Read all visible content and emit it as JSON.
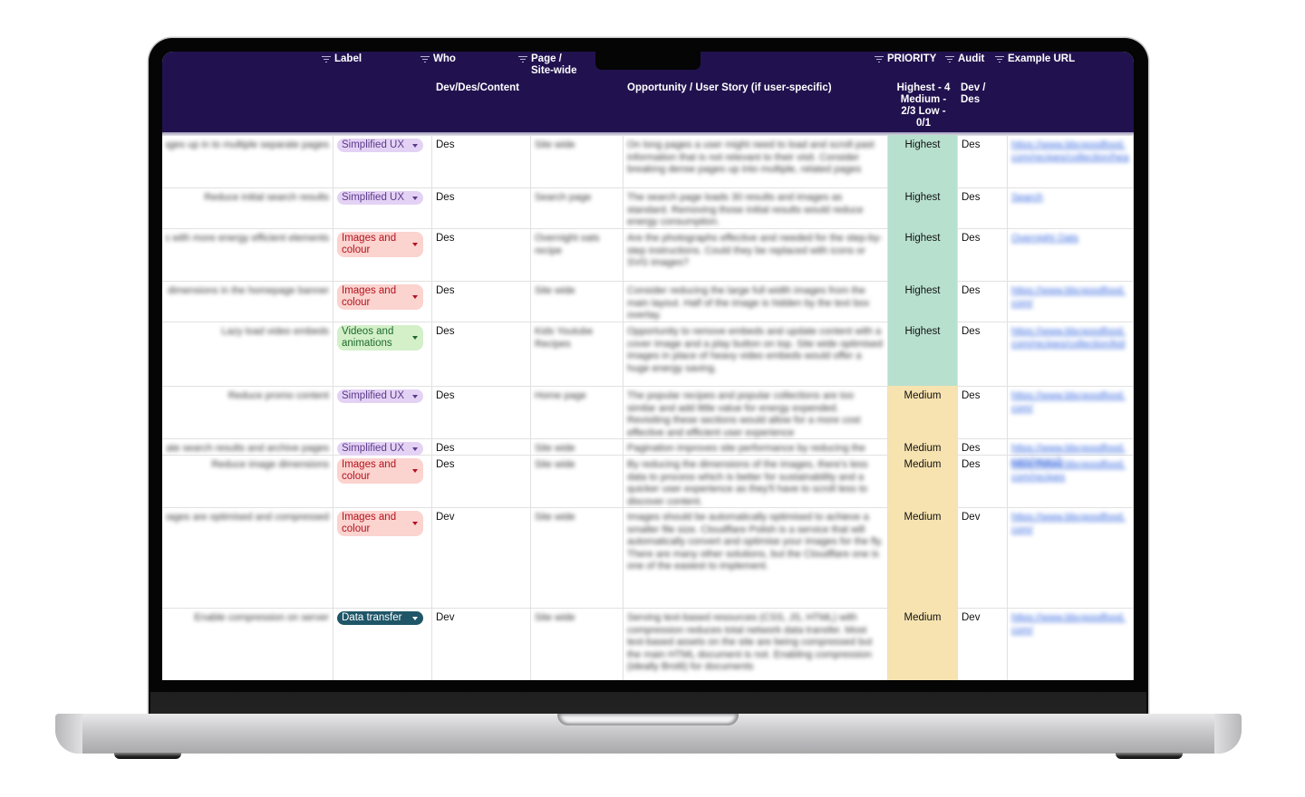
{
  "colors": {
    "header_bg": "#21124f",
    "highest": "#b8e0cf",
    "medium": "#f7e3b0",
    "chip_ux": "#e4d2f5",
    "chip_img": "#fbd3cf",
    "chip_vid": "#d3f0c9",
    "chip_dt": "#1e5668"
  },
  "header": {
    "columns": [
      {
        "name": "Label",
        "sub": ""
      },
      {
        "name": "Who",
        "sub": "Dev/Des/Content"
      },
      {
        "name": "Page / Site-wide",
        "sub": ""
      },
      {
        "name": "",
        "sub": "Opportunity / User Story (if user-specific)"
      },
      {
        "name": "PRIORITY",
        "sub": "Highest - 4 Medium - 2/3 Low - 0/1"
      },
      {
        "name": "Audit",
        "sub": "Dev / Des"
      },
      {
        "name": "Example URL",
        "sub": ""
      }
    ],
    "filter_icon": "filter-icon"
  },
  "rows": [
    {
      "title": "Break long pages up in to multiple separate pages",
      "label": "Simplified UX",
      "label_type": "ux",
      "who": "Des",
      "page": "Site wide",
      "opportunity": "On long pages a user might need to load and scroll past information that is not relevant to their visit. Consider breaking dense pages up into multiple, related pages",
      "priority": "Highest",
      "audit": "Des",
      "url": "https://www.bbcgoodfood.com/recipes/collection/healthy-lunch-recipes"
    },
    {
      "title": "Reduce initial search results",
      "label": "Simplified UX",
      "label_type": "ux",
      "who": "Des",
      "page": "Search page",
      "opportunity": "The search page loads 30 results and images as standard. Removing those initial results would reduce energy consumption.",
      "priority": "Highest",
      "audit": "Des",
      "url": "Search"
    },
    {
      "title": "Replace images with more energy efficient elements",
      "label": "Images and colour",
      "label_type": "img",
      "who": "Des",
      "page": "Overnight oats recipe",
      "opportunity": "Are the photographs effective and needed for the step-by-step instructions. Could they be replaced with icons or SVG images?",
      "priority": "Highest",
      "audit": "Des",
      "url": "Overnight Oats"
    },
    {
      "title": "Reduce image dimensions in the homepage banner",
      "label": "Images and colour",
      "label_type": "img",
      "who": "Des",
      "page": "Site wide",
      "opportunity": "Consider reducing the large full width images from the main layout. Half of the image is hidden by the text box overlay.",
      "priority": "Highest",
      "audit": "Des",
      "url": "https://www.bbcgoodfood.com/"
    },
    {
      "title": "Lazy load video embeds",
      "label": "Videos and animations",
      "label_type": "vid",
      "who": "Des",
      "page": "Kids Youtube Recipes",
      "opportunity": "Opportunity to remove embeds and update content with a cover image and a play button on top. Site wide optimised images in place of heavy video embeds would offer a huge energy saving.",
      "priority": "Highest",
      "audit": "Des",
      "url": "https://www.bbcgoodfood.com/recipes/collection/kids-baking"
    },
    {
      "title": "Reduce promo content",
      "label": "Simplified UX",
      "label_type": "ux",
      "who": "Des",
      "page": "Home page",
      "opportunity": "The popular recipes and popular collections are too similar and add little value for energy expended. Revisiting these sections would allow for a more cost effective and efficient user experience",
      "priority": "Medium",
      "audit": "Des",
      "url": "https://www.bbcgoodfood.com/"
    },
    {
      "title": "Paginate search results and archive pages",
      "label": "Simplified UX",
      "label_type": "ux",
      "who": "Des",
      "page": "Site wide",
      "opportunity": "Pagination improves site performance by reducing the",
      "priority": "Medium",
      "audit": "Des",
      "url": "https://www.bbcgoodfood.com/search"
    },
    {
      "title": "Reduce image dimensions",
      "label": "Images and colour",
      "label_type": "img",
      "who": "Des",
      "page": "Site wide",
      "opportunity": "By reducing the dimensions of the images, there's less data to process which is better for sustainability and a quicker user experience as they'll have to scroll less to discover content.",
      "priority": "Medium",
      "audit": "Des",
      "url": "https://www.bbcgoodfood.com/recipes"
    },
    {
      "title": "Images are optimised and compressed",
      "label": "Images and colour",
      "label_type": "img",
      "who": "Dev",
      "page": "Site wide",
      "opportunity": "Images should be automatically optimised to achieve a smaller file size. Cloudflare Polish is a service that will automatically convert and optimise your images for the fly. There are many other solutions, but the Cloudflare one is one of the easiest to implement.",
      "priority": "Medium",
      "audit": "Dev",
      "url": "https://www.bbcgoodfood.com/"
    },
    {
      "title": "Enable compression on server",
      "label": "Data transfer",
      "label_type": "dt",
      "who": "Dev",
      "page": "Site wide",
      "opportunity": "Serving text-based resources (CSS, JS, HTML) with compression reduces total network data transfer. Most text-based assets on the site are being compressed but the main HTML document is not. Enabling compression (ideally Brotli) for documents",
      "priority": "Medium",
      "audit": "Dev",
      "url": "https://www.bbcgoodfood.com/"
    }
  ]
}
